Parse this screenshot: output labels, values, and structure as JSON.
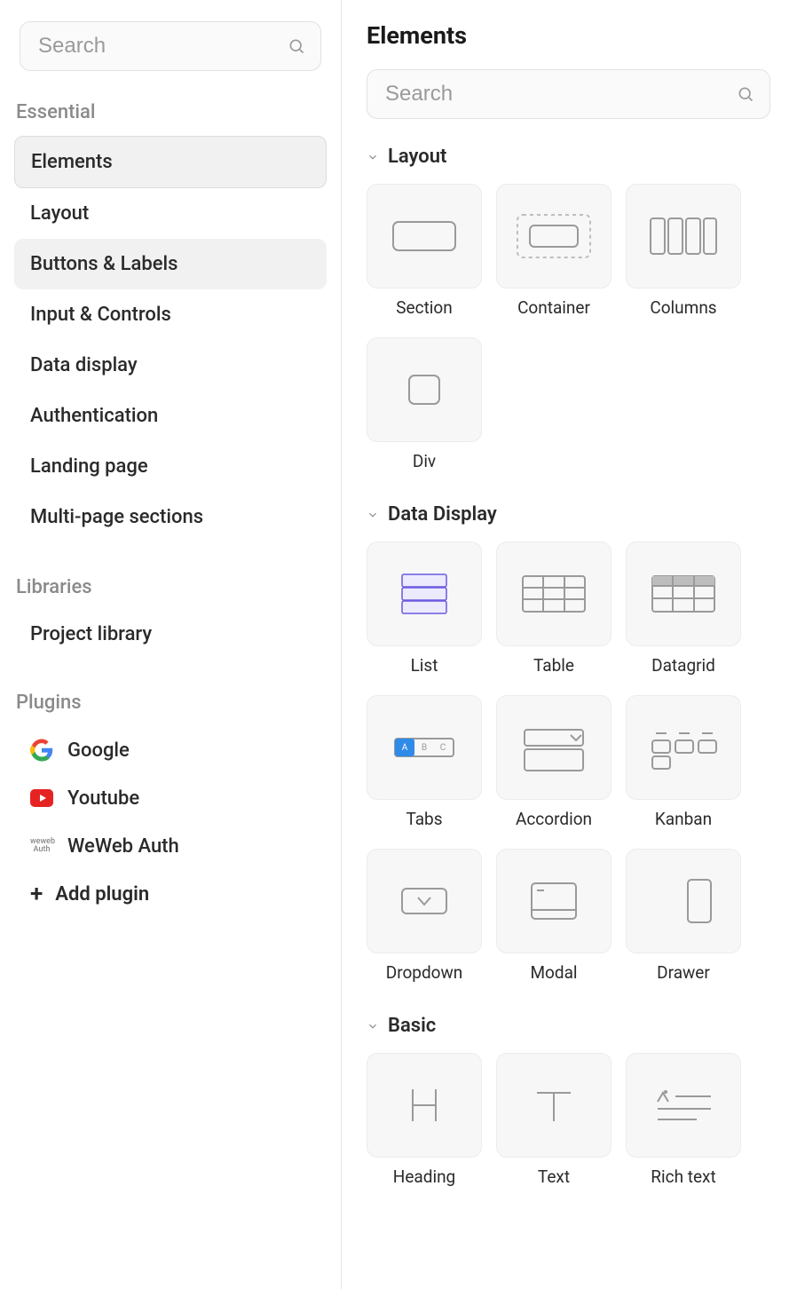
{
  "sidebar": {
    "search_placeholder": "Search",
    "essential_heading": "Essential",
    "essential_items": [
      {
        "label": "Elements",
        "state": "selected"
      },
      {
        "label": "Layout",
        "state": ""
      },
      {
        "label": "Buttons & Labels",
        "state": "hover"
      },
      {
        "label": "Input & Controls",
        "state": ""
      },
      {
        "label": "Data display",
        "state": ""
      },
      {
        "label": "Authentication",
        "state": ""
      },
      {
        "label": "Landing page",
        "state": ""
      },
      {
        "label": "Multi-page sections",
        "state": ""
      }
    ],
    "libraries_heading": "Libraries",
    "library_items": [
      {
        "label": "Project library"
      }
    ],
    "plugins_heading": "Plugins",
    "plugin_items": [
      {
        "label": "Google",
        "icon": "google"
      },
      {
        "label": "Youtube",
        "icon": "youtube"
      },
      {
        "label": "WeWeb Auth",
        "icon": "weweb"
      }
    ],
    "add_plugin_label": "Add plugin"
  },
  "main": {
    "title": "Elements",
    "search_placeholder": "Search",
    "categories": [
      {
        "name": "Layout",
        "tiles": [
          {
            "label": "Section",
            "thumb": "section"
          },
          {
            "label": "Container",
            "thumb": "container"
          },
          {
            "label": "Columns",
            "thumb": "columns"
          },
          {
            "label": "Div",
            "thumb": "div"
          }
        ]
      },
      {
        "name": "Data Display",
        "tiles": [
          {
            "label": "List",
            "thumb": "list"
          },
          {
            "label": "Table",
            "thumb": "table"
          },
          {
            "label": "Datagrid",
            "thumb": "datagrid"
          },
          {
            "label": "Tabs",
            "thumb": "tabs"
          },
          {
            "label": "Accordion",
            "thumb": "accordion"
          },
          {
            "label": "Kanban",
            "thumb": "kanban"
          },
          {
            "label": "Dropdown",
            "thumb": "dropdown"
          },
          {
            "label": "Modal",
            "thumb": "modal"
          },
          {
            "label": "Drawer",
            "thumb": "drawer"
          }
        ]
      },
      {
        "name": "Basic",
        "tiles": [
          {
            "label": "Heading",
            "thumb": "heading"
          },
          {
            "label": "Text",
            "thumb": "text"
          },
          {
            "label": "Rich text",
            "thumb": "richtext"
          }
        ]
      }
    ]
  }
}
